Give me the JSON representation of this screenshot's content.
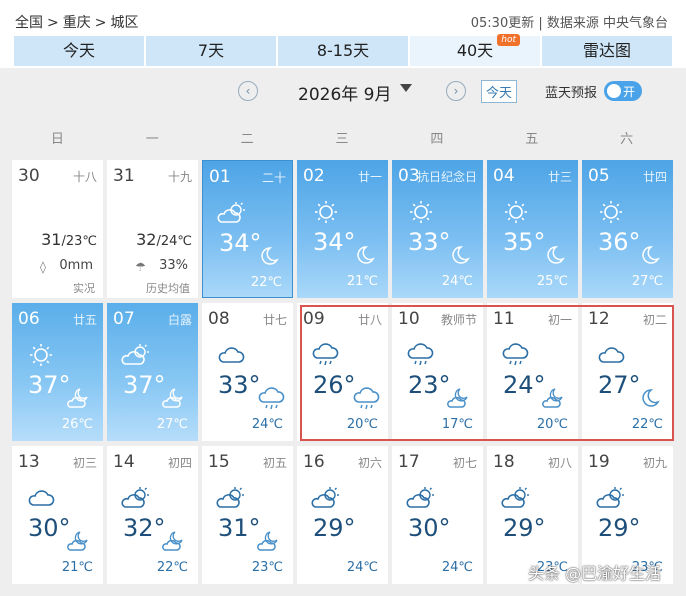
{
  "breadcrumb": [
    "全国",
    ">",
    "重庆",
    ">",
    "城区"
  ],
  "source_text": "05:30更新 | 数据来源 中央气象台",
  "tabs": [
    {
      "label": "今天",
      "active": false
    },
    {
      "label": "7天",
      "active": false
    },
    {
      "label": "8-15天",
      "active": false
    },
    {
      "label": "40天",
      "active": true,
      "badge": "hot"
    },
    {
      "label": "雷达图",
      "active": false
    }
  ],
  "month": {
    "label": "2026年 9月",
    "today_button": "今天",
    "blue_sky_label": "蓝天预报",
    "toggle_label": "开"
  },
  "weekdays": [
    "日",
    "一",
    "二",
    "三",
    "四",
    "五",
    "六"
  ],
  "colors": {
    "accent": "#4da4e6",
    "highlight_border": "#d9534f",
    "tab_bg": "#cfe6f8"
  },
  "days": [
    {
      "date": "30",
      "lunar": "十八",
      "past": true,
      "high": "31",
      "low": "23℃",
      "sub": "0mm",
      "sub_icon": "drop-icon",
      "note": "实况"
    },
    {
      "date": "31",
      "lunar": "十九",
      "past": true,
      "high": "32",
      "low": "24℃",
      "sub": "33%",
      "sub_icon": "rain-cloud-icon",
      "note": "历史均值"
    },
    {
      "date": "01",
      "lunar": "二十",
      "style": "hot1",
      "today": true,
      "high": "34°",
      "low": "22℃",
      "day_icon": "partly-cloudy-icon",
      "night_icon": "moon-icon"
    },
    {
      "date": "02",
      "lunar": "廿一",
      "style": "hot1",
      "high": "34°",
      "low": "21℃",
      "day_icon": "sunny-icon",
      "night_icon": "moon-icon"
    },
    {
      "date": "03",
      "lunar": "抗日纪念日",
      "style": "hot1",
      "high": "33°",
      "low": "24℃",
      "day_icon": "sunny-icon",
      "night_icon": "moon-icon"
    },
    {
      "date": "04",
      "lunar": "廿三",
      "style": "hot1",
      "high": "35°",
      "low": "25℃",
      "day_icon": "sunny-icon",
      "night_icon": "moon-icon"
    },
    {
      "date": "05",
      "lunar": "廿四",
      "style": "hot1",
      "high": "36°",
      "low": "27℃",
      "day_icon": "sunny-icon",
      "night_icon": "moon-icon"
    },
    {
      "date": "06",
      "lunar": "廿五",
      "style": "hot2",
      "high": "37°",
      "low": "26℃",
      "day_icon": "sunny-icon",
      "night_icon": "partly-cloudy-night-icon"
    },
    {
      "date": "07",
      "lunar": "白露",
      "style": "hot2",
      "high": "37°",
      "low": "27℃",
      "day_icon": "partly-cloudy-icon",
      "night_icon": "partly-cloudy-night-icon"
    },
    {
      "date": "08",
      "lunar": "廿七",
      "high": "33°",
      "low": "24℃",
      "day_icon": "cloudy-icon",
      "night_icon": "rain-icon"
    },
    {
      "date": "09",
      "lunar": "廿八",
      "high": "26°",
      "low": "20℃",
      "day_icon": "rain-icon",
      "night_icon": "rain-icon"
    },
    {
      "date": "10",
      "lunar": "教师节",
      "high": "23°",
      "low": "17℃",
      "day_icon": "rain-icon",
      "night_icon": "partly-cloudy-night-icon"
    },
    {
      "date": "11",
      "lunar": "初一",
      "high": "24°",
      "low": "20℃",
      "day_icon": "rain-icon",
      "night_icon": "partly-cloudy-night-icon"
    },
    {
      "date": "12",
      "lunar": "初二",
      "high": "27°",
      "low": "22℃",
      "day_icon": "cloudy-icon",
      "night_icon": "moon-icon"
    },
    {
      "date": "13",
      "lunar": "初三",
      "high": "30°",
      "low": "21℃",
      "day_icon": "cloudy-icon",
      "night_icon": "partly-cloudy-night-icon"
    },
    {
      "date": "14",
      "lunar": "初四",
      "high": "32°",
      "low": "22℃",
      "day_icon": "partly-cloudy-icon",
      "night_icon": "partly-cloudy-night-icon"
    },
    {
      "date": "15",
      "lunar": "初五",
      "high": "31°",
      "low": "23℃",
      "day_icon": "partly-cloudy-icon",
      "night_icon": "partly-cloudy-night-icon"
    },
    {
      "date": "16",
      "lunar": "初六",
      "high": "29°",
      "low": "24℃",
      "day_icon": "partly-cloudy-icon",
      "night_icon": ""
    },
    {
      "date": "17",
      "lunar": "初七",
      "high": "30°",
      "low": "24℃",
      "day_icon": "partly-cloudy-icon",
      "night_icon": ""
    },
    {
      "date": "18",
      "lunar": "初八",
      "high": "29°",
      "low": "23℃",
      "day_icon": "partly-cloudy-icon",
      "night_icon": ""
    },
    {
      "date": "19",
      "lunar": "初九",
      "high": "29°",
      "low": "23℃",
      "day_icon": "partly-cloudy-icon",
      "night_icon": ""
    }
  ],
  "watermark": "头条 @巴渝好生活"
}
